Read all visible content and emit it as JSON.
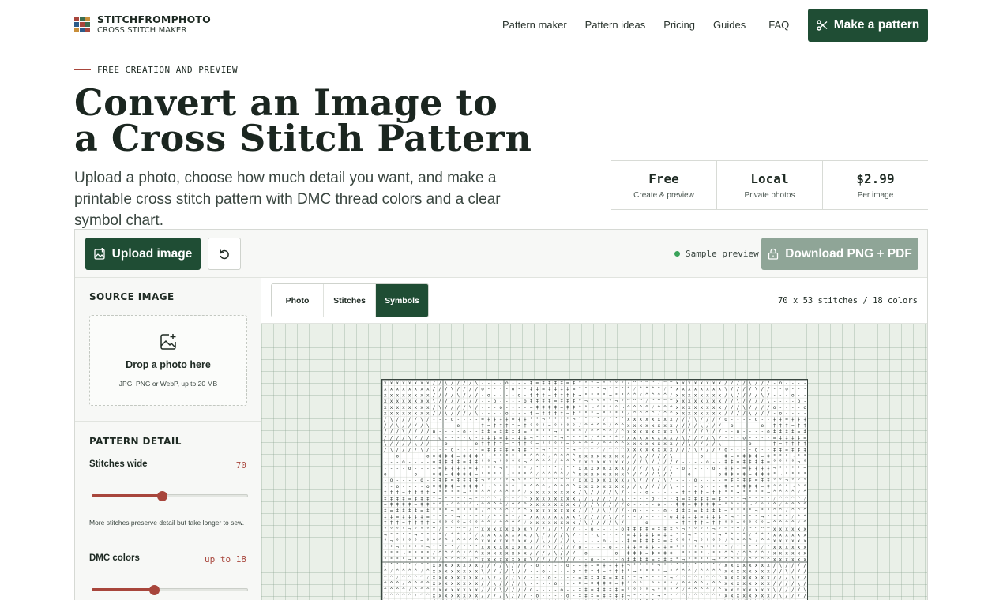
{
  "header": {
    "logo_name": "STITCHFROMPHOTO",
    "logo_sub": "CROSS STITCH MAKER",
    "logo_colors": [
      "#a8463c",
      "#3c6e4f",
      "#c98f3a",
      "#2d5c8a",
      "#a8463c",
      "#3c6e4f",
      "#c98f3a",
      "#2d5c8a",
      "#a8463c"
    ],
    "nav": [
      {
        "label": "Pattern maker"
      },
      {
        "label": "Pattern ideas"
      },
      {
        "label": "Pricing"
      },
      {
        "label": "Guides"
      },
      {
        "label": "FAQ"
      }
    ],
    "cta_label": "Make a pattern",
    "cta_icon": "scissors-icon"
  },
  "hero": {
    "eyebrow": "FREE CREATION AND PREVIEW",
    "title_line1": "Convert an Image to",
    "title_line2": "a Cross Stitch Pattern",
    "description": "Upload a photo, choose how much detail you want, and make a printable cross stitch pattern with DMC thread colors and a clear symbol chart."
  },
  "stats": [
    {
      "value": "Free",
      "label": "Create & preview"
    },
    {
      "value": "Local",
      "label": "Private photos"
    },
    {
      "value": "$2.99",
      "label": "Per image"
    }
  ],
  "toolbar": {
    "upload_label": "Upload image",
    "upload_icon": "image-upload-icon",
    "reset_icon": "reset-icon",
    "status_text": "Sample preview",
    "download_label": "Download PNG + PDF",
    "download_icon": "lock-icon"
  },
  "sidebar": {
    "source_title": "SOURCE IMAGE",
    "drop_title": "Drop a photo here",
    "drop_sub": "JPG, PNG or WebP, up to 20 MB",
    "detail_title": "PATTERN DETAIL",
    "stitches_label": "Stitches wide",
    "stitches_value": "70",
    "stitches_fraction": 0.45,
    "hint": "More stitches preserve detail but take longer to sew.",
    "colors_label": "DMC colors",
    "colors_value": "up to 18",
    "colors_fraction": 0.4
  },
  "viewer": {
    "tabs": [
      {
        "label": "Photo",
        "active": false
      },
      {
        "label": "Stitches",
        "active": false
      },
      {
        "label": "Symbols",
        "active": true
      }
    ],
    "dims": "70 x 53 stitches / 18 colors",
    "accent": "#1f4d34",
    "thread_accent": "#a8463c"
  }
}
